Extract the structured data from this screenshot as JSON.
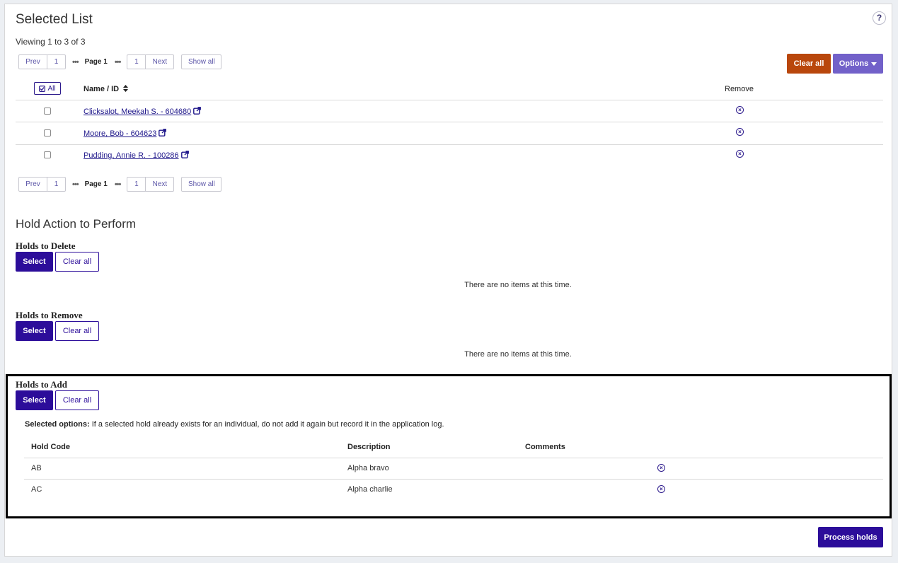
{
  "header": {
    "title": "Selected List",
    "help_label": "?"
  },
  "viewing": "Viewing 1 to 3 of 3",
  "pager": {
    "prev": "Prev",
    "first_page": "1",
    "ellipsis": "•••",
    "current": "Page 1",
    "last_page": "1",
    "next": "Next",
    "show_all": "Show all"
  },
  "actions": {
    "clear_all": "Clear all",
    "options": "Options"
  },
  "table": {
    "select_all": "All",
    "col_name": "Name / ID",
    "col_remove": "Remove",
    "rows": [
      {
        "name": "Clicksalot, Meekah S. - 604680"
      },
      {
        "name": "Moore, Bob - 604623"
      },
      {
        "name": "Pudding, Annie R. - 100286"
      }
    ]
  },
  "hold_action": {
    "title": "Hold Action to Perform",
    "delete": {
      "title": "Holds to Delete",
      "select": "Select",
      "clear": "Clear all",
      "empty": "There are no items at this time."
    },
    "remove": {
      "title": "Holds to Remove",
      "select": "Select",
      "clear": "Clear all",
      "empty": "There are no items at this time."
    },
    "add": {
      "title": "Holds to Add",
      "select": "Select",
      "clear": "Clear all",
      "options_label": "Selected options:",
      "options_text": "If a selected hold already exists for an individual, do not add it again but record it in the application log.",
      "columns": {
        "code": "Hold Code",
        "description": "Description",
        "comments": "Comments"
      },
      "rows": [
        {
          "code": "AB",
          "description": "Alpha bravo",
          "comments": ""
        },
        {
          "code": "AC",
          "description": "Alpha charlie",
          "comments": ""
        }
      ]
    }
  },
  "footer": {
    "process": "Process holds"
  },
  "colors": {
    "primary": "#2c0d9a",
    "orange": "#b9470c",
    "options": "#7261c9"
  }
}
